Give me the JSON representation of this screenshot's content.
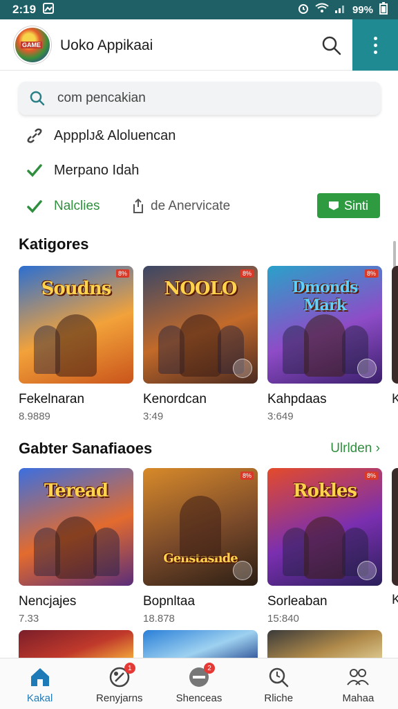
{
  "status_bar": {
    "time": "2:19",
    "battery": "99%"
  },
  "app_bar": {
    "title": "Uoko Appikaai",
    "logo_text": "GAME"
  },
  "search": {
    "text": "com pencakian"
  },
  "suggestions": [
    {
      "label": "Appplᴊ& Aloluencan",
      "icon": "link-icon"
    },
    {
      "label": "Merpano Idah",
      "icon": "check-link-icon"
    }
  ],
  "filters": {
    "left": "Nalclies",
    "middle": "de Anervicate",
    "button": "Sinti"
  },
  "categories": {
    "title": "Katigores",
    "items": [
      {
        "name": "Fekelnaran",
        "meta": "8.9889",
        "art": "Soudns",
        "corner": "8%"
      },
      {
        "name": "Kenordcan",
        "meta": "3:49",
        "art": "NOOLO",
        "corner": "8%"
      },
      {
        "name": "Kahpdaas",
        "meta": "3:649",
        "art": "Dmonds Mark",
        "corner": "8%"
      }
    ],
    "peek": "K"
  },
  "games_section": {
    "title": "Gabter Sanafiaoes",
    "more": "Ulrlden ›",
    "items": [
      {
        "name": "Nencjajes",
        "meta": "7.33",
        "art": "Teread",
        "corner": ""
      },
      {
        "name": "Bopnltaa",
        "meta": "18.878",
        "art": "Genstasnde",
        "corner": "8%"
      },
      {
        "name": "Sorleaban",
        "meta": "15:840",
        "art": "Rokles",
        "corner": "8%"
      }
    ],
    "peek": "K"
  },
  "bottom_nav": [
    {
      "label": "Kakal",
      "icon": "home-icon",
      "active": true,
      "badge": ""
    },
    {
      "label": "Renyjarns",
      "icon": "controller-icon",
      "active": false,
      "badge": "1"
    },
    {
      "label": "Shenceas",
      "icon": "download-icon",
      "active": false,
      "badge": "2"
    },
    {
      "label": "Rliche",
      "icon": "search-icon",
      "active": false,
      "badge": ""
    },
    {
      "label": "Mahaa",
      "icon": "people-icon",
      "active": false,
      "badge": ""
    }
  ],
  "colors": {
    "accent": "#2e9b41",
    "teal": "#1f8a92",
    "status": "#1f5f66"
  }
}
